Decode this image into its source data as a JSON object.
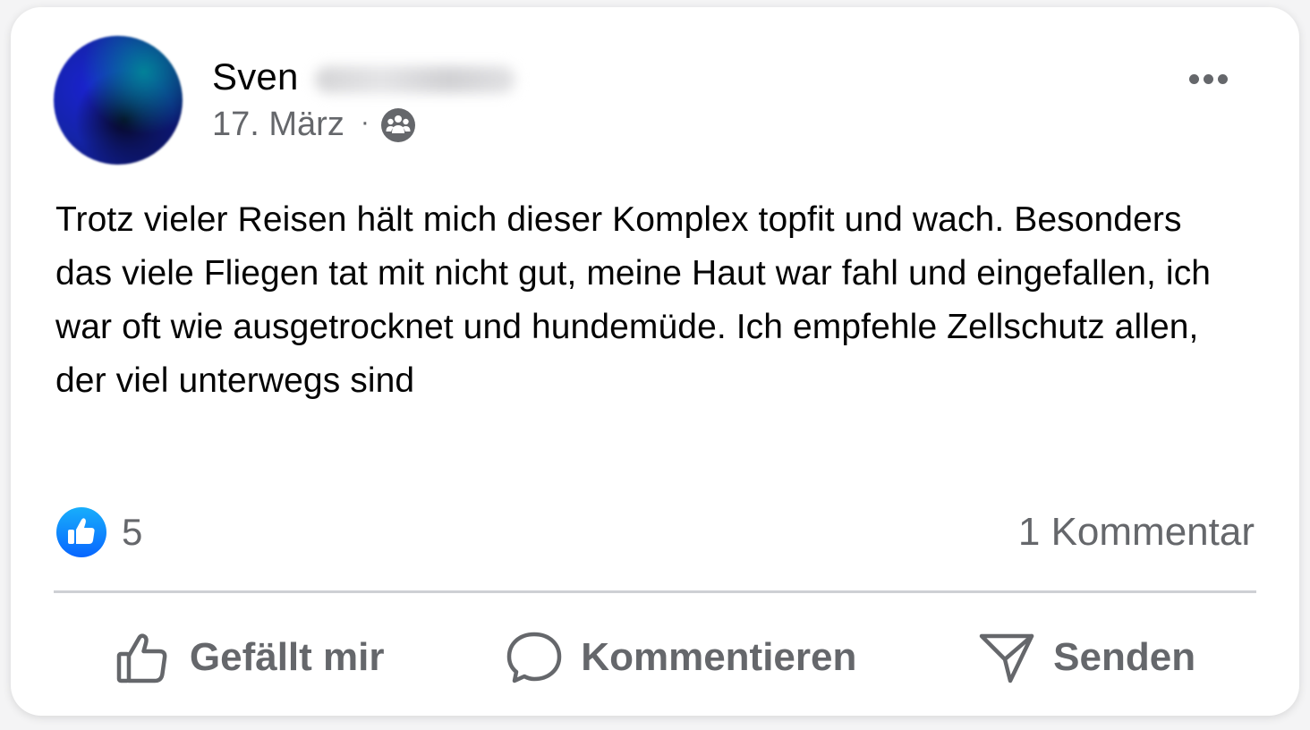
{
  "post": {
    "author_first_name": "Sven",
    "date": "17. März",
    "separator": "·",
    "audience_icon": "friends-icon",
    "text": "Trotz vieler Reisen hält mich dieser Komplex topfit und wach. Besonders das viele Fliegen tat mit nicht gut, meine Haut war fahl und eingefallen, ich war oft wie ausgetrocknet und hundemüde. Ich empfehle Zellschutz allen, der viel unterwegs sind",
    "reaction_count": "5",
    "comment_count": "1 Kommentar"
  },
  "actions": {
    "like_label": "Gefällt mir",
    "comment_label": "Kommentieren",
    "send_label": "Senden"
  },
  "colors": {
    "text_primary": "#050505",
    "text_secondary": "#65676b",
    "like_blue": "#1877f2",
    "divider": "#ced0d4"
  }
}
